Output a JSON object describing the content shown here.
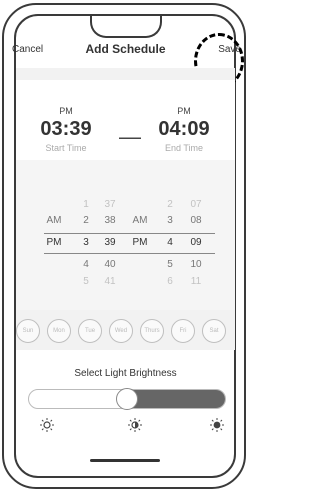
{
  "nav": {
    "cancel": "Cancel",
    "title": "Add Schedule",
    "save": "Save"
  },
  "start": {
    "ampm": "PM",
    "time": "03:39",
    "label": "Start Time"
  },
  "end": {
    "ampm": "PM",
    "time": "04:09",
    "label": "End Time"
  },
  "separator": "—",
  "picker": {
    "rows": [
      {
        "sampm": "",
        "shour": "1",
        "smin": "37",
        "eampm": "",
        "ehour": "2",
        "emin": "07"
      },
      {
        "sampm": "AM",
        "shour": "2",
        "smin": "38",
        "eampm": "AM",
        "ehour": "3",
        "emin": "08"
      },
      {
        "sampm": "PM",
        "shour": "3",
        "smin": "39",
        "eampm": "PM",
        "ehour": "4",
        "emin": "09"
      },
      {
        "sampm": "",
        "shour": "4",
        "smin": "40",
        "eampm": "",
        "ehour": "5",
        "emin": "10"
      },
      {
        "sampm": "",
        "shour": "5",
        "smin": "41",
        "eampm": "",
        "ehour": "6",
        "emin": "11"
      }
    ]
  },
  "days": [
    "Sun",
    "Mon",
    "Tue",
    "Wed",
    "Thurs",
    "Fri",
    "Sat"
  ],
  "brightness": {
    "label": "Select Light Brightness",
    "value_fraction": 0.5
  },
  "icons": {
    "dim": "sun-low-icon",
    "mid": "sun-half-icon",
    "bright": "sun-full-icon"
  },
  "colors": {
    "text": "#333333",
    "muted": "#aaaaaa",
    "slider_fill": "#666666"
  }
}
